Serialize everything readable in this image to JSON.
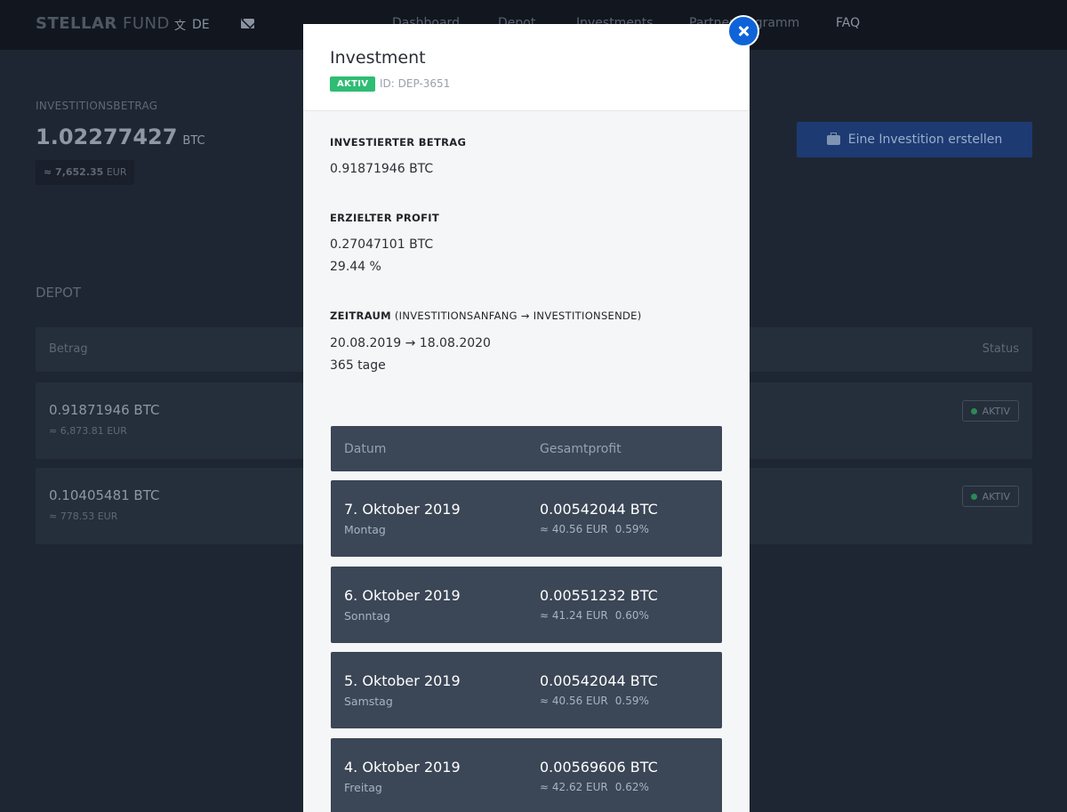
{
  "header": {
    "logo_bold": "STELLAR",
    "logo_light": " FUND",
    "lang": "DE",
    "lang_icon": "translate-icon",
    "mail_icon": "envelope-icon",
    "nav": [
      "Dashboard",
      "Depot",
      "Investments",
      "Partnerprogramm",
      "FAQ"
    ]
  },
  "summary": {
    "label": "INVESTITIONSBETRAG",
    "amount": "1.02277427",
    "unit": "BTC",
    "eur": "≈ 7,652.35",
    "eur_unit": "EUR",
    "create_button": "Eine Investition erstellen"
  },
  "depot": {
    "title": "DEPOT",
    "col_amount": "Betrag",
    "col_status": "Status",
    "rows": [
      {
        "amount": "0.91871946 BTC",
        "eur": "≈ 6,873.81 EUR",
        "status": "AKTIV"
      },
      {
        "amount": "0.10405481 BTC",
        "eur": "≈ 778.53 EUR",
        "status": "AKTIV"
      }
    ]
  },
  "modal": {
    "title": "Investment",
    "status": "AKTIV",
    "id": "ID: DEP-3651",
    "invested_label": "INVESTIERTER BETRAG",
    "invested_value": "0.91871946 BTC",
    "profit_label": "ERZIELTER PROFIT",
    "profit_btc": "0.27047101 BTC",
    "profit_pct": "29.44 %",
    "period_label": "ZEITRAUM",
    "period_sub": " (INVESTITIONSANFANG → INVESTITIONSENDE)",
    "period_value": "20.08.2019 → 18.08.2020",
    "period_days": "365 tage",
    "table": {
      "col_date": "Datum",
      "col_profit": "Gesamtprofit",
      "rows": [
        {
          "date": "7. Oktober 2019",
          "day": "Montag",
          "btc": "0.00542044 BTC",
          "eur": "≈ 40.56 EUR",
          "pct": "0.59%"
        },
        {
          "date": "6. Oktober 2019",
          "day": "Sonntag",
          "btc": "0.00551232 BTC",
          "eur": "≈ 41.24 EUR",
          "pct": "0.60%"
        },
        {
          "date": "5. Oktober 2019",
          "day": "Samstag",
          "btc": "0.00542044 BTC",
          "eur": "≈ 40.56 EUR",
          "pct": "0.59%"
        },
        {
          "date": "4. Oktober 2019",
          "day": "Freitag",
          "btc": "0.00569606 BTC",
          "eur": "≈ 42.62 EUR",
          "pct": "0.62%"
        }
      ]
    }
  }
}
